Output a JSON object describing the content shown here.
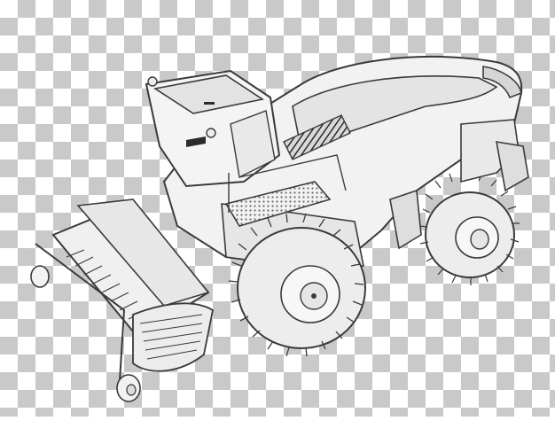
{
  "image": {
    "subject": "forage-harvester",
    "background": "transparency-checkerboard",
    "colors": {
      "checker_light": "#ffffff",
      "checker_dark": "#c9c9c9",
      "body_fill": "#f2f2f2",
      "body_shade": "#d9d9d9",
      "outline": "#3a3a3a",
      "tire": "#ededed",
      "dark_detail": "#2b2b2b"
    }
  }
}
